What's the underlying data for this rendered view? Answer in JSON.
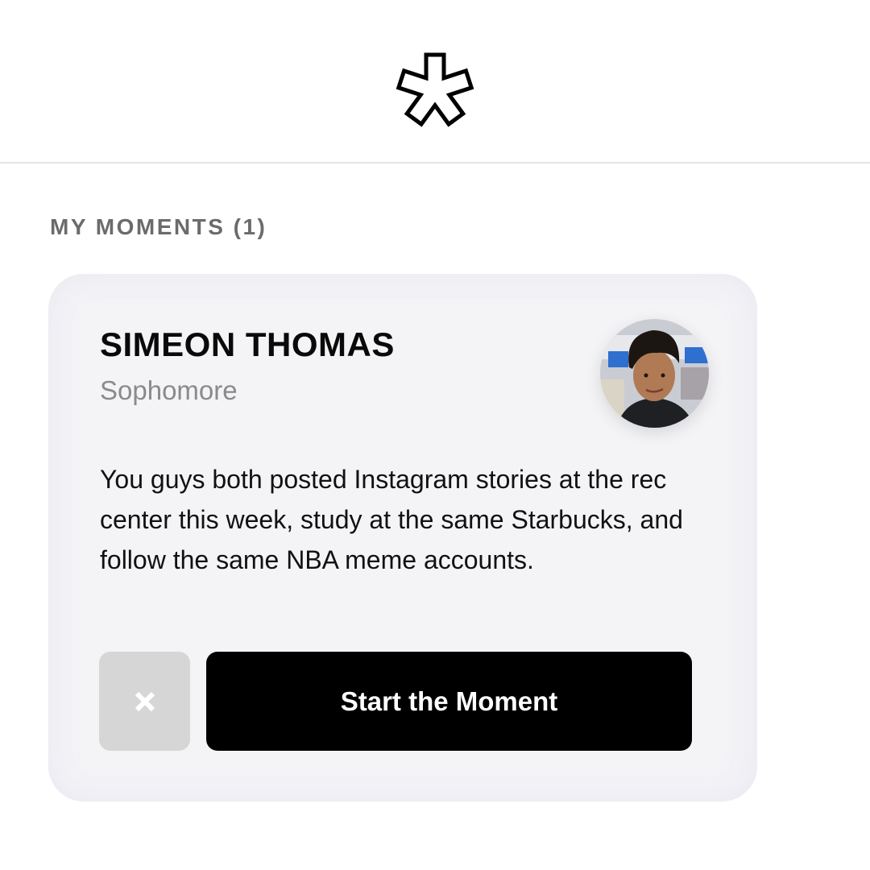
{
  "header": {
    "logo_icon": "asterisk-logo-icon"
  },
  "section": {
    "title": "MY MOMENTS (1)"
  },
  "moment": {
    "name": "SIMEON THOMAS",
    "year": "Sophomore",
    "description": "You guys both posted Instagram stories at the rec center this week, study at the same Starbucks, and follow the same NBA meme accounts.",
    "dismiss_icon": "close-icon",
    "start_label": "Start the Moment"
  }
}
